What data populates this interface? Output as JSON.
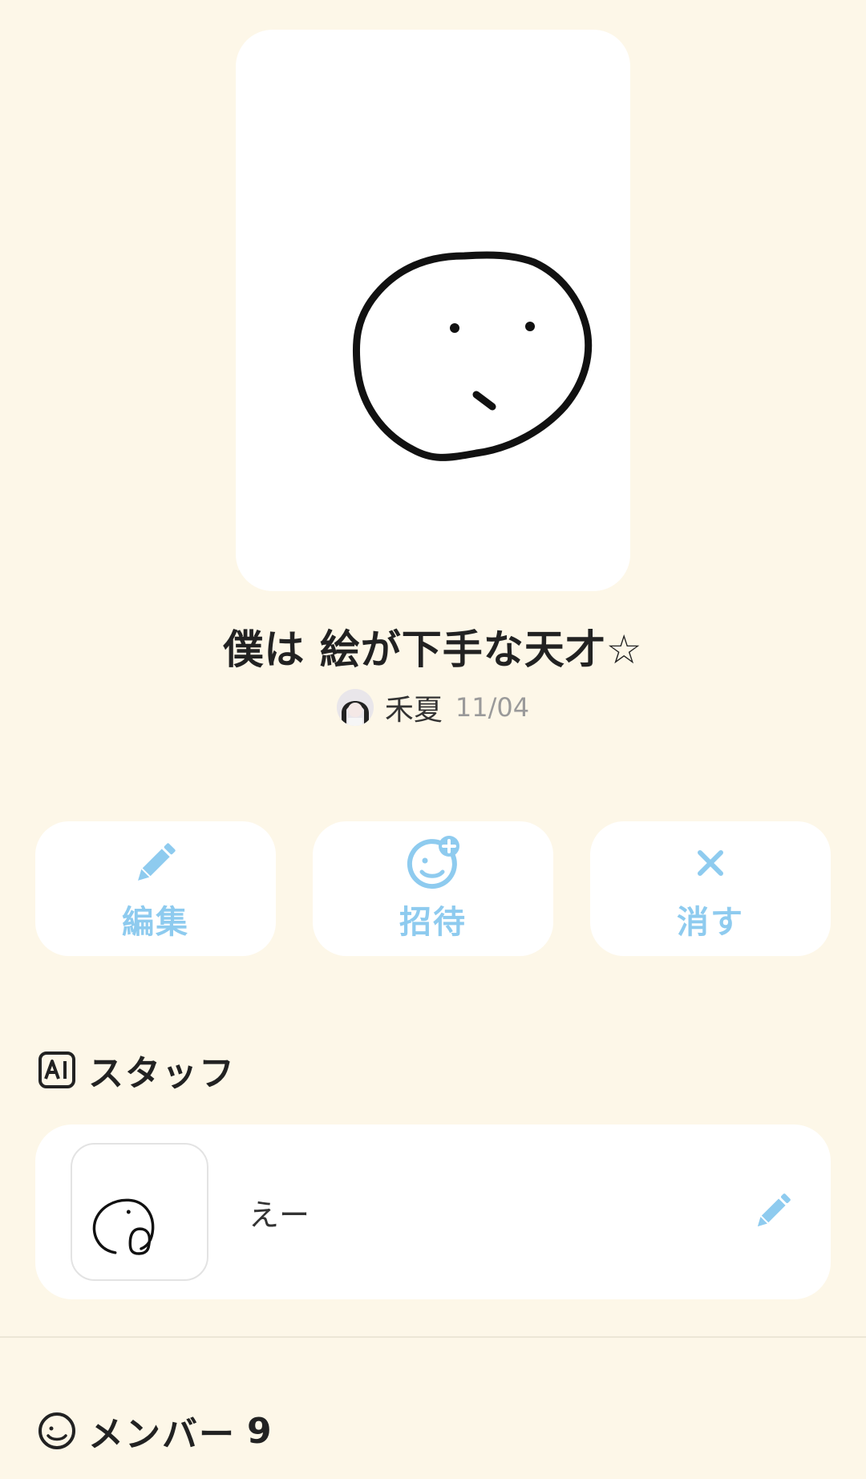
{
  "post": {
    "title": "僕は 絵が下手な天才☆",
    "author_name": "禾夏",
    "date": "11/04"
  },
  "actions": {
    "edit_label": "編集",
    "invite_label": "招待",
    "delete_label": "消す"
  },
  "staff_section": {
    "title": "スタッフ",
    "items": [
      {
        "name": "えー"
      }
    ]
  },
  "members_section": {
    "title": "メンバー",
    "count": "9"
  },
  "colors": {
    "background": "#fdf7e8",
    "accent": "#8ecbef",
    "card": "#ffffff",
    "text": "#222222"
  },
  "icons": {
    "edit": "pencil-icon",
    "invite": "smiley-plus-icon",
    "delete": "close-icon",
    "staff": "ai-badge-icon",
    "members": "smiley-icon"
  }
}
